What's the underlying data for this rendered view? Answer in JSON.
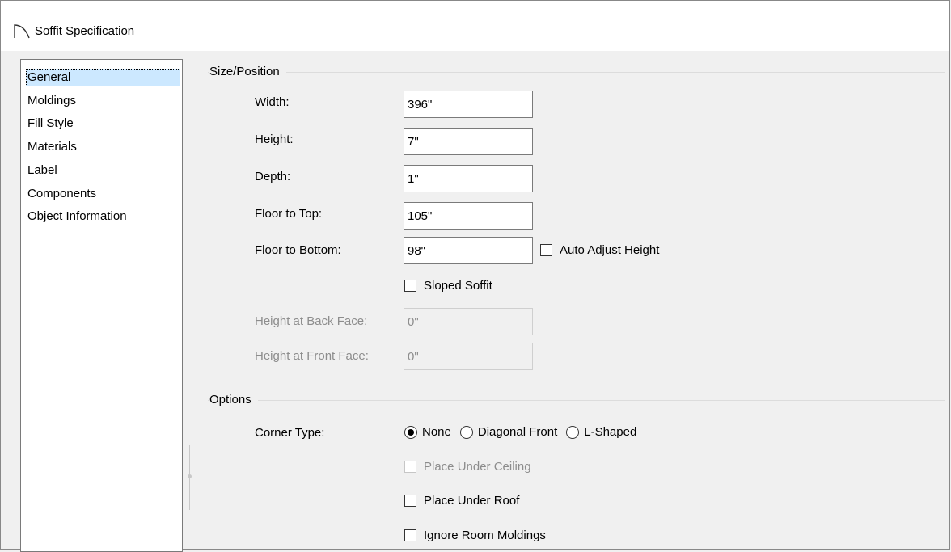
{
  "window": {
    "title": "Soffit Specification",
    "icon": "soffit-arc-icon"
  },
  "nav": {
    "items": [
      {
        "label": "General",
        "selected": true
      },
      {
        "label": "Moldings"
      },
      {
        "label": "Fill Style"
      },
      {
        "label": "Materials"
      },
      {
        "label": "Label"
      },
      {
        "label": "Components"
      },
      {
        "label": "Object Information"
      }
    ]
  },
  "size_position": {
    "heading": "Size/Position",
    "width": {
      "label": "Width:",
      "value": "396\""
    },
    "height": {
      "label": "Height:",
      "value": "7\""
    },
    "depth": {
      "label": "Depth:",
      "value": "1\""
    },
    "floor_to_top": {
      "label": "Floor to Top:",
      "value": "105\""
    },
    "floor_to_bottom": {
      "label": "Floor to Bottom:",
      "value": "98\""
    },
    "auto_adjust_height": {
      "label": "Auto Adjust Height",
      "checked": false
    },
    "sloped_soffit": {
      "label": "Sloped Soffit",
      "checked": false
    },
    "height_back_face": {
      "label": "Height at Back Face:",
      "value": "0\"",
      "disabled": true
    },
    "height_front_face": {
      "label": "Height at Front Face:",
      "value": "0\"",
      "disabled": true
    }
  },
  "options": {
    "heading": "Options",
    "corner_type": {
      "label": "Corner Type:",
      "choices": [
        "None",
        "Diagonal Front",
        "L-Shaped"
      ],
      "selected": "None"
    },
    "place_under_ceiling": {
      "label": "Place Under Ceiling",
      "checked": false,
      "disabled": true
    },
    "place_under_roof": {
      "label": "Place Under Roof",
      "checked": false
    },
    "ignore_room_moldings": {
      "label": "Ignore Room Moldings",
      "checked": false
    }
  }
}
